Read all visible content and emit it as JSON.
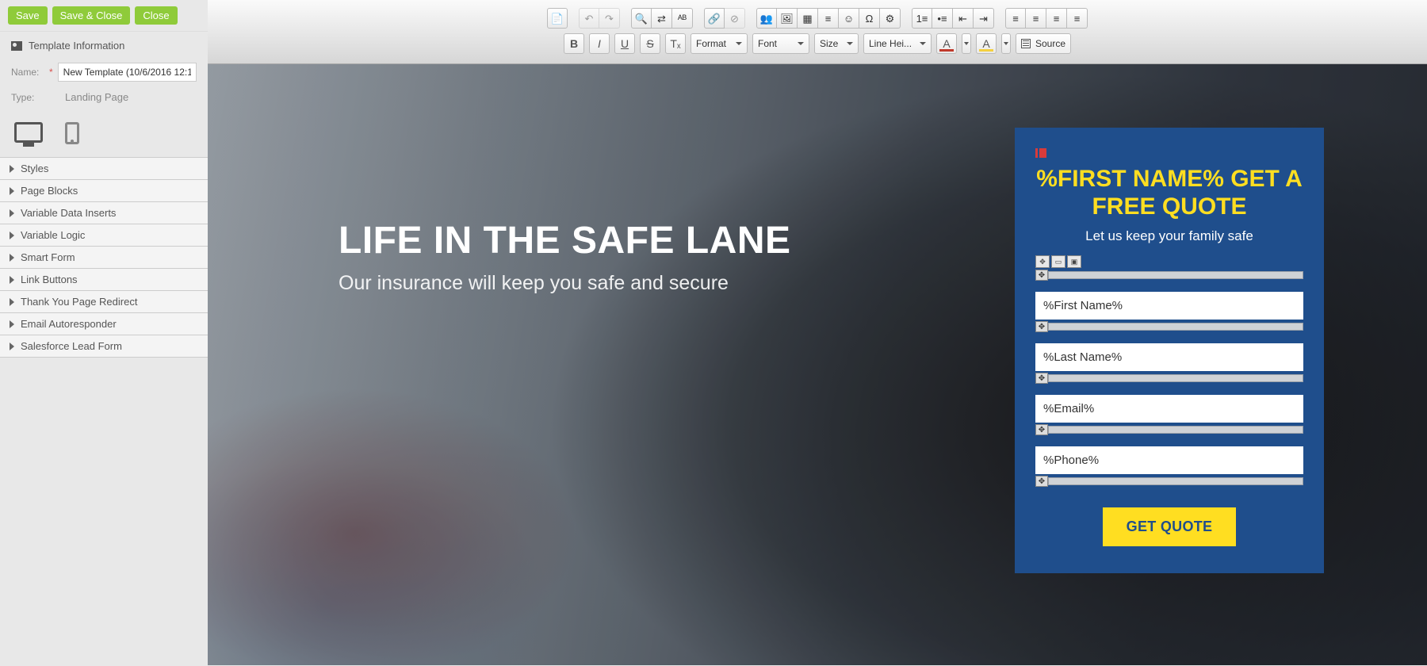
{
  "sidebar": {
    "buttons": {
      "save": "Save",
      "saveClose": "Save & Close",
      "close": "Close"
    },
    "section_title": "Template Information",
    "name_label": "Name:",
    "name_value": "New Template (10/6/2016 12:1",
    "type_label": "Type:",
    "type_value": "Landing Page",
    "accordion": [
      "Styles",
      "Page Blocks",
      "Variable Data Inserts",
      "Variable Logic",
      "Smart Form",
      "Link Buttons",
      "Thank You Page Redirect",
      "Email Autoresponder",
      "Salesforce Lead Form"
    ]
  },
  "toolbar": {
    "combos": {
      "format": "Format",
      "font": "Font",
      "size": "Size",
      "lineheight": "Line Hei..."
    },
    "source": "Source",
    "row1_groups": [
      [
        "templates-icon"
      ],
      [
        "undo-icon",
        "redo-icon"
      ],
      [
        "find-icon",
        "replace-icon",
        "spellcheck-icon"
      ],
      [
        "link-icon",
        "unlink-icon"
      ],
      [
        "smartform-icon",
        "image-icon",
        "table-icon",
        "hr-icon",
        "specialchar-icon",
        "omega-icon",
        "gear-icon"
      ],
      [
        "ol-icon",
        "ul-icon",
        "outdent-icon",
        "indent-icon"
      ],
      [
        "align-left-icon",
        "align-center-icon",
        "align-right-icon",
        "align-justify-icon"
      ]
    ],
    "glyphs": {
      "templates-icon": "📄",
      "undo-icon": "↶",
      "redo-icon": "↷",
      "find-icon": "🔍",
      "replace-icon": "⇄",
      "spellcheck-icon": "ᴬᴮ",
      "link-icon": "🔗",
      "unlink-icon": "⊘",
      "smartform-icon": "👥",
      "image-icon": "🖼",
      "table-icon": "▦",
      "hr-icon": "≡",
      "specialchar-icon": "☺",
      "omega-icon": "Ω",
      "gear-icon": "⚙",
      "ol-icon": "1≡",
      "ul-icon": "•≡",
      "outdent-icon": "⇤",
      "indent-icon": "⇥",
      "align-left-icon": "≡",
      "align-center-icon": "≡",
      "align-right-icon": "≡",
      "align-justify-icon": "≡",
      "bold": "B",
      "italic": "I",
      "underline": "U",
      "strike": "S",
      "clear-fmt": "Tₓ",
      "text-color": "A",
      "bg-color": "A"
    }
  },
  "hero": {
    "title": "LIFE IN THE SAFE LANE",
    "subtitle": "Our insurance will keep you safe and secure"
  },
  "form": {
    "title_line1": "%FIRST NAME% GET A",
    "title_line2": "FREE QUOTE",
    "subtitle": "Let us keep your family safe",
    "fields": [
      "%First Name%",
      "%Last Name%",
      "%Email%",
      "%Phone%"
    ],
    "cta": "GET QUOTE"
  }
}
